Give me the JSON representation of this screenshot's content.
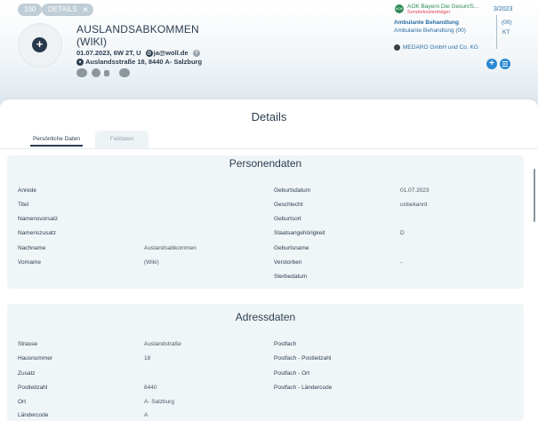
{
  "header": {
    "chip_count": "100",
    "chip_details": "DETAILS",
    "chip_close": "✕",
    "add_icon": "+",
    "name_line1": "AUSLANDSABKOMMEN",
    "name_line2": "(WIKI)",
    "info": "01.07.2023, 6W 2T, U",
    "email": "ja@woll.de",
    "address": "Auslandsstraße 18, 8440 A- Salzburg"
  },
  "insurance": {
    "logo": "AOK",
    "name": "AOK Bayern Die Gesun/S...",
    "sub": "Sonderkostenträger",
    "quarter": "3/2023",
    "line1": "Ambulante Behandlung",
    "line2": "Ambulante Behandlung (00)",
    "col1": "(00)",
    "col2": "KT",
    "provider": "MEDARO GmbH und Co. KG",
    "add_icon": "+"
  },
  "details": {
    "title": "Details",
    "tabs": [
      "Persönliche Daten",
      "Falldaten"
    ]
  },
  "personendaten": {
    "title": "Personendaten",
    "left": [
      {
        "label": "Anrede",
        "value": ""
      },
      {
        "label": "Titel",
        "value": ""
      },
      {
        "label": "Namensvorsatz",
        "value": ""
      },
      {
        "label": "Namenszusatz",
        "value": ""
      },
      {
        "label": "Nachname",
        "value": "Auslandsabkommen"
      },
      {
        "label": "Vorname",
        "value": "(Wiki)"
      }
    ],
    "right": [
      {
        "label": "Geburtsdatum",
        "value": "01.07.2023"
      },
      {
        "label": "Geschlecht",
        "value": "unbekannt"
      },
      {
        "label": "Geburtsort",
        "value": ""
      },
      {
        "label": "Staatsangehörigkeit",
        "value": "D"
      },
      {
        "label": "Geburtsname",
        "value": ""
      },
      {
        "label": "Verstorben",
        "value": "-"
      },
      {
        "label": "Sterbedatum",
        "value": ""
      }
    ]
  },
  "adressdaten": {
    "title": "Adressdaten",
    "left": [
      {
        "label": "Strasse",
        "value": "Auslandstraße"
      },
      {
        "label": "Hausnummer",
        "value": "18"
      },
      {
        "label": "Zusatz",
        "value": ""
      },
      {
        "label": "Postleitzahl",
        "value": "8440"
      },
      {
        "label": "Ort",
        "value": "A- Salzburg"
      },
      {
        "label": "Ländercode",
        "value": "A"
      }
    ],
    "right": [
      {
        "label": "Postfach",
        "value": ""
      },
      {
        "label": "Postfach - Postleitzahl",
        "value": ""
      },
      {
        "label": "Postfach - Ort",
        "value": ""
      },
      {
        "label": "Postfach - Ländercode",
        "value": ""
      }
    ]
  }
}
